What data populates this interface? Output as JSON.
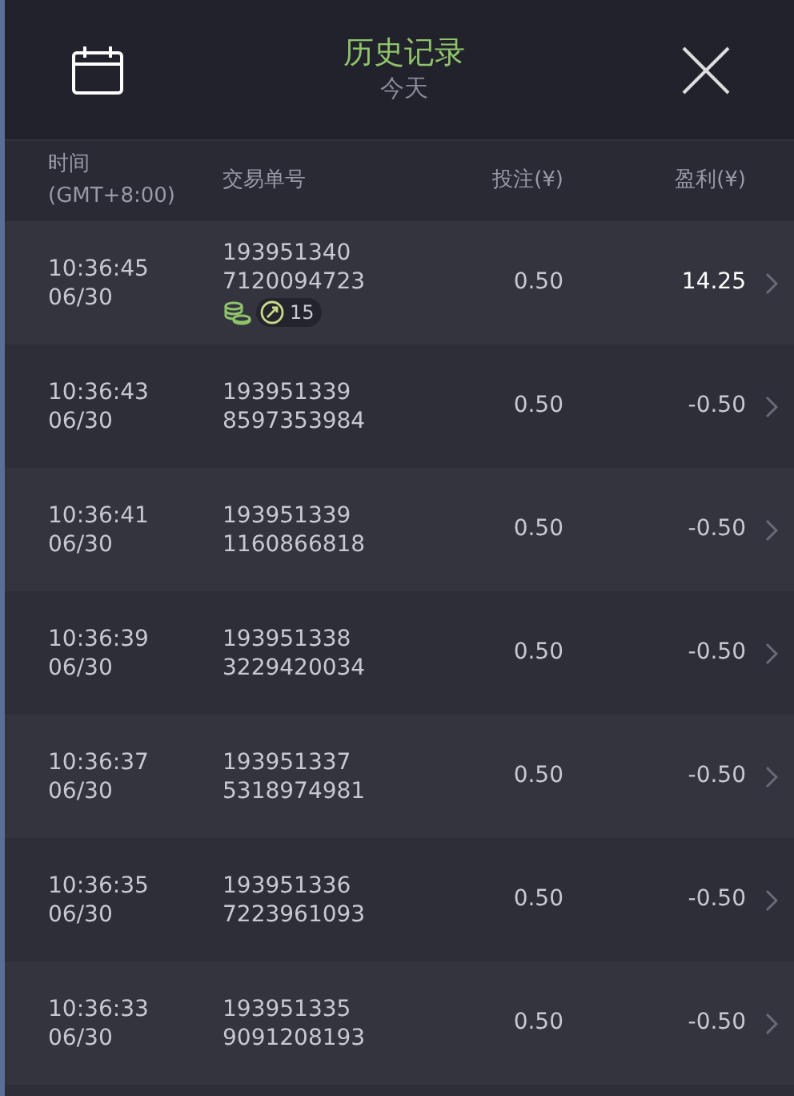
{
  "header": {
    "title": "历史记录",
    "subtitle": "今天"
  },
  "columns": {
    "time": "时间",
    "timezone": "(GMT+8:00)",
    "order": "交易单号",
    "bet": "投注(¥)",
    "profit": "盈利(¥)"
  },
  "rows": [
    {
      "time": "10:36:45",
      "date": "06/30",
      "order_1": "193951340",
      "order_2": "7120094723",
      "bet": "0.50",
      "profit": "14.25",
      "win": true,
      "bonus_count": "15"
    },
    {
      "time": "10:36:43",
      "date": "06/30",
      "order_1": "193951339",
      "order_2": "8597353984",
      "bet": "0.50",
      "profit": "-0.50",
      "win": false
    },
    {
      "time": "10:36:41",
      "date": "06/30",
      "order_1": "193951339",
      "order_2": "1160866818",
      "bet": "0.50",
      "profit": "-0.50",
      "win": false
    },
    {
      "time": "10:36:39",
      "date": "06/30",
      "order_1": "193951338",
      "order_2": "3229420034",
      "bet": "0.50",
      "profit": "-0.50",
      "win": false
    },
    {
      "time": "10:36:37",
      "date": "06/30",
      "order_1": "193951337",
      "order_2": "5318974981",
      "bet": "0.50",
      "profit": "-0.50",
      "win": false
    },
    {
      "time": "10:36:35",
      "date": "06/30",
      "order_1": "193951336",
      "order_2": "7223961093",
      "bet": "0.50",
      "profit": "-0.50",
      "win": false
    },
    {
      "time": "10:36:33",
      "date": "06/30",
      "order_1": "193951335",
      "order_2": "9091208193",
      "bet": "0.50",
      "profit": "-0.50",
      "win": false
    }
  ]
}
